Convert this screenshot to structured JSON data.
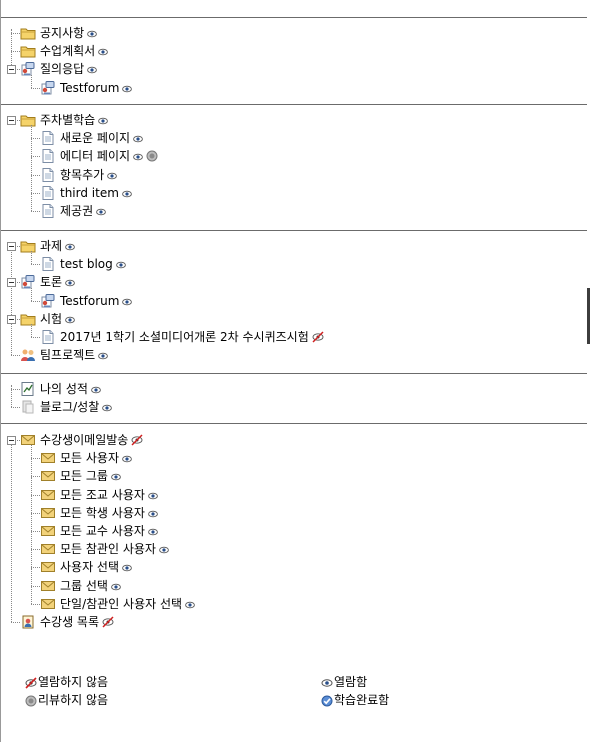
{
  "groups": [
    {
      "items": [
        {
          "label": "공지사항",
          "icon": "folder-icon",
          "level": 0,
          "status": "viewed"
        },
        {
          "label": "수업계획서",
          "icon": "folder-icon",
          "level": 0,
          "status": "viewed"
        },
        {
          "label": "질의응답",
          "icon": "forum-icon",
          "level": 0,
          "status": "viewed",
          "expanded": true
        },
        {
          "label": "Testforum",
          "icon": "forum-icon",
          "level": 1,
          "status": "viewed"
        }
      ]
    },
    {
      "items": [
        {
          "label": "주차별학습",
          "icon": "folder-icon",
          "level": 0,
          "status": "viewed",
          "expanded": true
        },
        {
          "label": "새로운 페이지",
          "icon": "page-icon",
          "level": 1,
          "status": "viewed"
        },
        {
          "label": "에디터 페이지",
          "icon": "page-icon",
          "level": 1,
          "status": "viewed",
          "status2": "not-reviewed"
        },
        {
          "label": "항목추가",
          "icon": "page-icon",
          "level": 1,
          "status": "viewed"
        },
        {
          "label": "third item",
          "icon": "page-icon",
          "level": 1,
          "status": "viewed"
        },
        {
          "label": "제공권",
          "icon": "page-icon",
          "level": 1,
          "status": "viewed"
        }
      ]
    },
    {
      "items": [
        {
          "label": "과제",
          "icon": "folder-icon",
          "level": 0,
          "status": "viewed",
          "expanded": true
        },
        {
          "label": "test blog",
          "icon": "page-icon",
          "level": 1,
          "status": "viewed"
        },
        {
          "label": "토론",
          "icon": "forum-icon",
          "level": 0,
          "status": "viewed",
          "expanded": true
        },
        {
          "label": "Testforum",
          "icon": "forum-icon",
          "level": 1,
          "status": "viewed"
        },
        {
          "label": "시험",
          "icon": "folder-icon",
          "level": 0,
          "status": "viewed",
          "expanded": true
        },
        {
          "label": "2017년 1학기 소셜미디어개론 2차 수시퀴즈시험",
          "icon": "page-icon",
          "level": 1,
          "status": "not-viewed"
        },
        {
          "label": "팀프로젝트",
          "icon": "team-icon",
          "level": 0,
          "status": "viewed"
        }
      ]
    },
    {
      "items": [
        {
          "label": "나의 성적",
          "icon": "grade-icon",
          "level": 0,
          "status": "viewed"
        },
        {
          "label": "블로그/성찰",
          "icon": "blog-icon",
          "level": 0,
          "status": "viewed"
        }
      ]
    },
    {
      "items": [
        {
          "label": "수강생이메일발송",
          "icon": "mail-icon",
          "level": 0,
          "status": "not-viewed",
          "expanded": true
        },
        {
          "label": "모든 사용자",
          "icon": "mail-icon",
          "level": 1,
          "status": "viewed"
        },
        {
          "label": "모든 그룹",
          "icon": "mail-icon",
          "level": 1,
          "status": "viewed"
        },
        {
          "label": "모든 조교 사용자",
          "icon": "mail-icon",
          "level": 1,
          "status": "viewed"
        },
        {
          "label": "모든 학생 사용자",
          "icon": "mail-icon",
          "level": 1,
          "status": "viewed"
        },
        {
          "label": "모든 교수 사용자",
          "icon": "mail-icon",
          "level": 1,
          "status": "viewed"
        },
        {
          "label": "모든 참관인 사용자",
          "icon": "mail-icon",
          "level": 1,
          "status": "viewed"
        },
        {
          "label": "사용자 선택",
          "icon": "mail-icon",
          "level": 1,
          "status": "viewed"
        },
        {
          "label": "그룹 선택",
          "icon": "mail-icon",
          "level": 1,
          "status": "viewed"
        },
        {
          "label": "단일/참관인 사용자 선택",
          "icon": "mail-icon",
          "level": 1,
          "status": "viewed"
        },
        {
          "label": "수강생 목록",
          "icon": "roster-icon",
          "level": 0,
          "status": "not-viewed"
        }
      ]
    }
  ],
  "legend": {
    "not_viewed": "열람하지 않음",
    "viewed": "열람함",
    "not_reviewed": "리뷰하지 않음",
    "completed": "학습완료함"
  },
  "colors": {
    "folder": "#f5d36a",
    "mail": "#f2d27a",
    "viewed": "#1e5a96",
    "not_viewed": "#c8322d"
  }
}
